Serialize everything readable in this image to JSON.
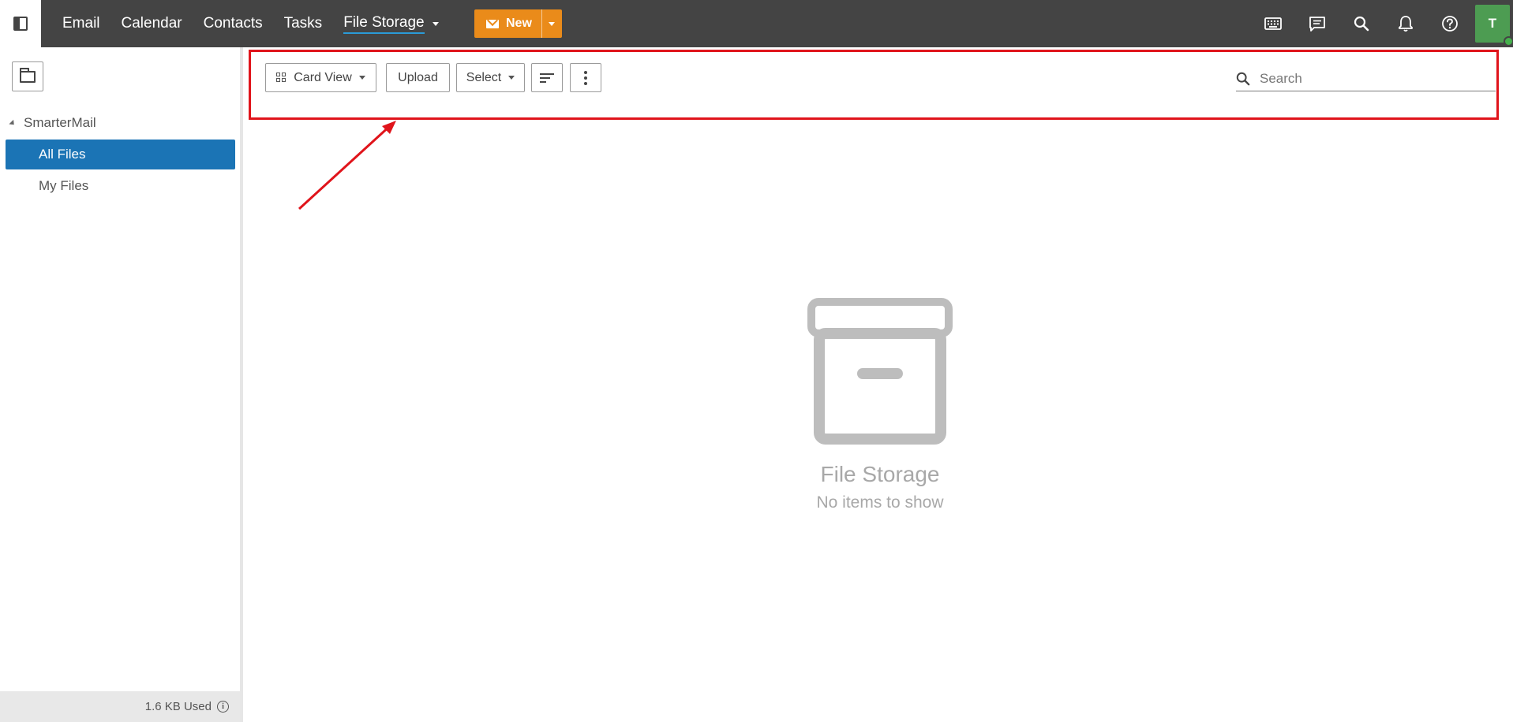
{
  "topbar": {
    "nav": [
      {
        "label": "Email"
      },
      {
        "label": "Calendar"
      },
      {
        "label": "Contacts"
      },
      {
        "label": "Tasks"
      },
      {
        "label": "File Storage"
      }
    ],
    "active_nav": "File Storage",
    "new_button_label": "New",
    "new_button_color": "#ea8b1a",
    "icons": [
      "keyboard-icon",
      "chat-icon",
      "search-icon",
      "bell-icon",
      "help-icon"
    ],
    "avatar_initial": "T",
    "avatar_color": "#4d9c52"
  },
  "sidebar": {
    "root_label": "SmarterMail",
    "items": [
      {
        "label": "All Files",
        "selected": true
      },
      {
        "label": "My Files",
        "selected": false
      }
    ],
    "storage_used": "1.6 KB Used",
    "selected_color": "#1b74b5"
  },
  "toolbar": {
    "view_label": "Card View",
    "upload_label": "Upload",
    "select_label": "Select",
    "search_placeholder": "Search"
  },
  "empty_state": {
    "title": "File Storage",
    "subtitle": "No items to show"
  },
  "annotation": {
    "highlight_color": "#e0141b"
  }
}
